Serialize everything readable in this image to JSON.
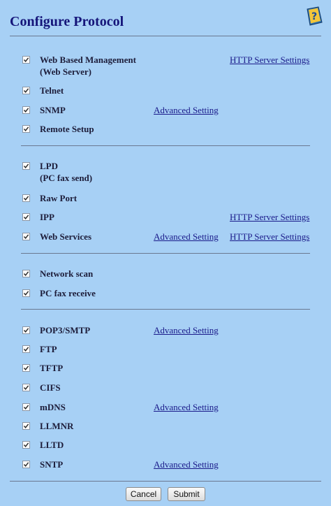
{
  "header": {
    "title": "Configure Protocol",
    "help_icon": "help-book-icon"
  },
  "sections": [
    [
      {
        "id": "web-based-management",
        "label": "Web Based Management",
        "label2": "(Web Server)",
        "checked": true,
        "mid_link": "",
        "right_link": "HTTP Server Settings"
      },
      {
        "id": "telnet",
        "label": "Telnet",
        "checked": true,
        "mid_link": "",
        "right_link": ""
      },
      {
        "id": "snmp",
        "label": "SNMP",
        "checked": true,
        "mid_link": "Advanced Setting",
        "right_link": ""
      },
      {
        "id": "remote-setup",
        "label": "Remote Setup",
        "checked": true,
        "mid_link": "",
        "right_link": ""
      }
    ],
    [
      {
        "id": "lpd",
        "label": "LPD",
        "label2": "(PC fax send)",
        "checked": true,
        "mid_link": "",
        "right_link": ""
      },
      {
        "id": "raw-port",
        "label": "Raw Port",
        "checked": true,
        "mid_link": "",
        "right_link": ""
      },
      {
        "id": "ipp",
        "label": "IPP",
        "checked": true,
        "mid_link": "",
        "right_link": "HTTP Server Settings"
      },
      {
        "id": "web-services",
        "label": "Web Services",
        "checked": true,
        "mid_link": "Advanced Setting",
        "right_link": "HTTP Server Settings"
      }
    ],
    [
      {
        "id": "network-scan",
        "label": "Network scan",
        "checked": true,
        "mid_link": "",
        "right_link": ""
      },
      {
        "id": "pc-fax-receive",
        "label": "PC fax receive",
        "checked": true,
        "mid_link": "",
        "right_link": ""
      }
    ],
    [
      {
        "id": "pop3-smtp",
        "label": "POP3/SMTP",
        "checked": true,
        "mid_link": "Advanced Setting",
        "right_link": ""
      },
      {
        "id": "ftp",
        "label": "FTP",
        "checked": true,
        "mid_link": "",
        "right_link": ""
      },
      {
        "id": "tftp",
        "label": "TFTP",
        "checked": true,
        "mid_link": "",
        "right_link": ""
      },
      {
        "id": "cifs",
        "label": "CIFS",
        "checked": true,
        "mid_link": "",
        "right_link": ""
      },
      {
        "id": "mdns",
        "label": "mDNS",
        "checked": true,
        "mid_link": "Advanced Setting",
        "right_link": ""
      },
      {
        "id": "llmnr",
        "label": "LLMNR",
        "checked": true,
        "mid_link": "",
        "right_link": ""
      },
      {
        "id": "lltd",
        "label": "LLTD",
        "checked": true,
        "mid_link": "",
        "right_link": ""
      },
      {
        "id": "sntp",
        "label": "SNTP",
        "checked": true,
        "mid_link": "Advanced Setting",
        "right_link": ""
      }
    ]
  ],
  "buttons": {
    "cancel": "Cancel",
    "submit": "Submit"
  }
}
